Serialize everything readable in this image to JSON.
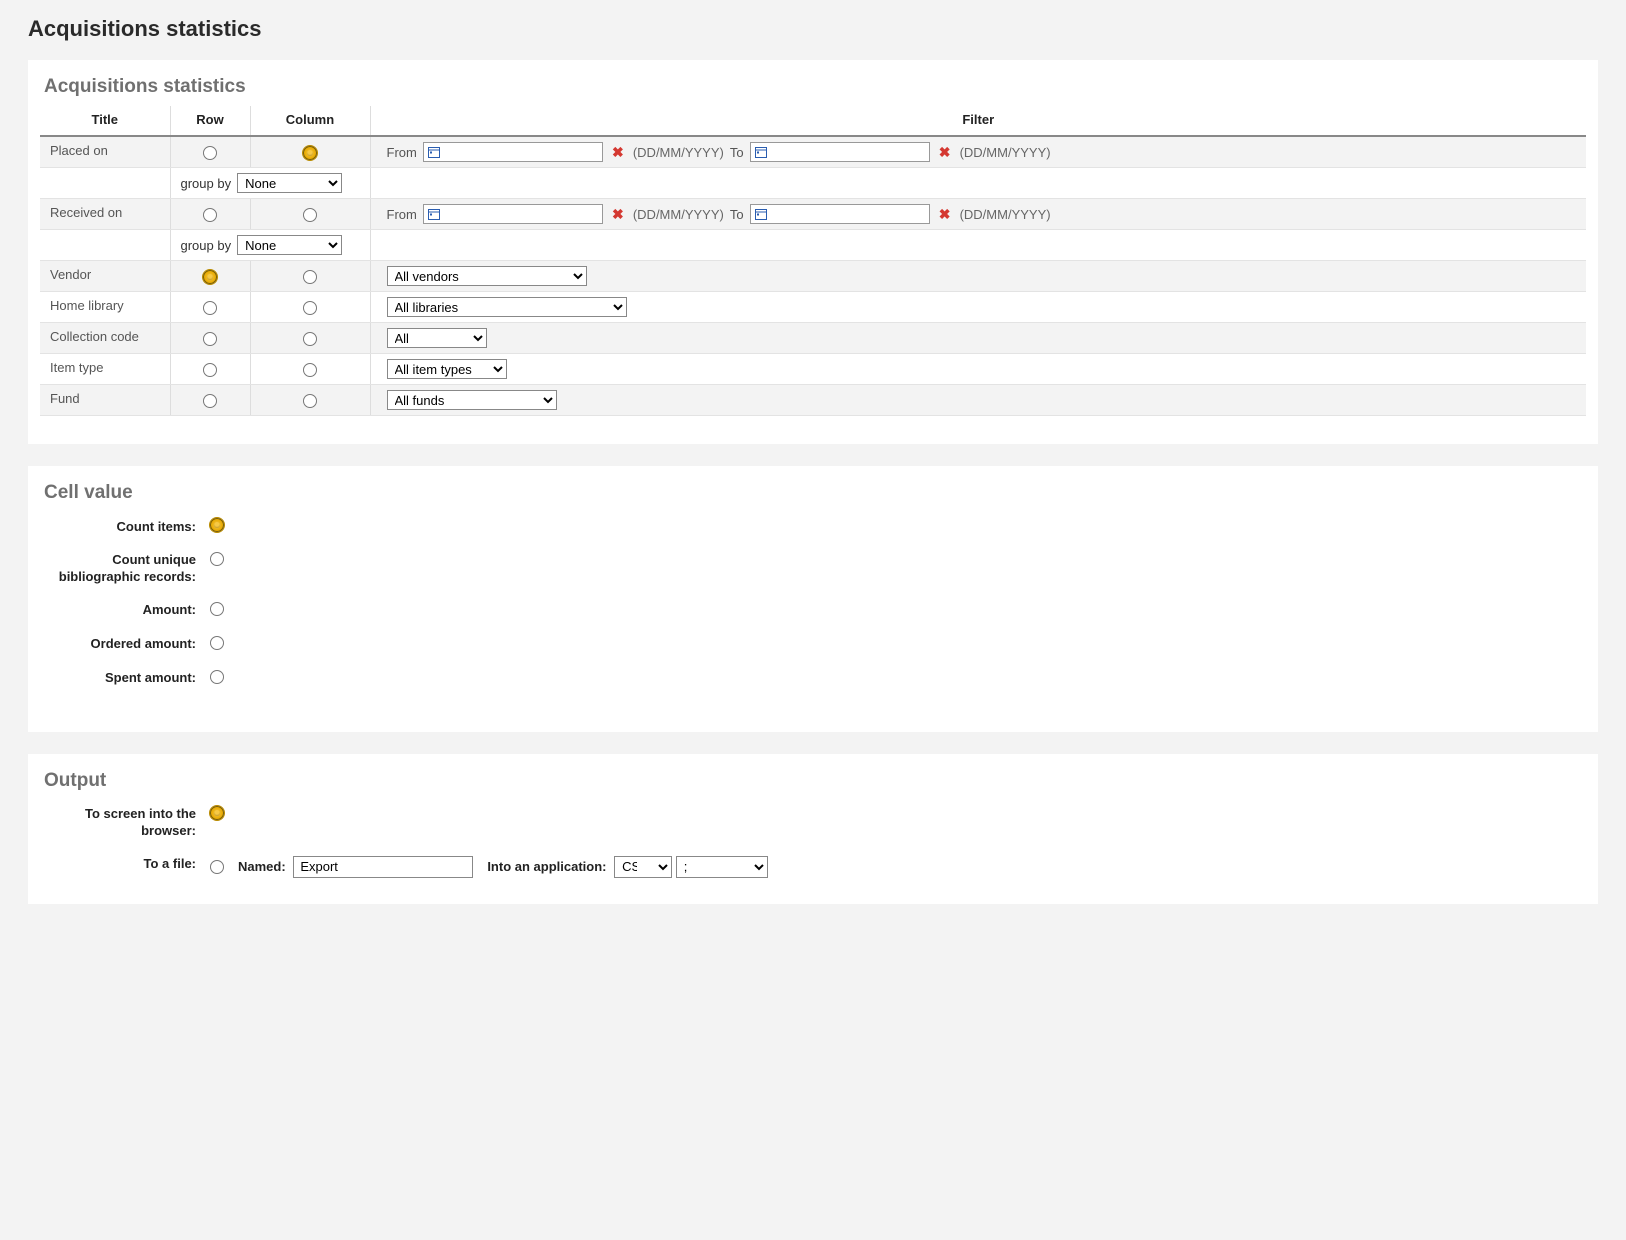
{
  "page": {
    "title": "Acquisitions statistics"
  },
  "section1": {
    "heading": "Acquisitions statistics",
    "headers": {
      "title": "Title",
      "row": "Row",
      "column": "Column",
      "filter": "Filter"
    },
    "rows": {
      "placed_on": "Placed on",
      "received_on": "Received on",
      "vendor": "Vendor",
      "home_library": "Home library",
      "collection_code": "Collection code",
      "item_type": "Item type",
      "fund": "Fund"
    },
    "group_by_label": "group by",
    "group_by_value": "None",
    "date_filter": {
      "from_label": "From",
      "to_label": "To",
      "hint": "(DD/MM/YYYY)"
    },
    "filters": {
      "vendor": "All vendors",
      "library": "All libraries",
      "collection": "All",
      "item_type": "All item types",
      "fund": "All funds"
    }
  },
  "section2": {
    "heading": "Cell value",
    "options": {
      "count_items": "Count items:",
      "count_unique": "Count unique bibliographic records:",
      "amount": "Amount:",
      "ordered_amount": "Ordered amount:",
      "spent_amount": "Spent amount:"
    }
  },
  "section3": {
    "heading": "Output",
    "to_screen_label": "To screen into the browser:",
    "to_file_label": "To a file:",
    "named_label": "Named:",
    "named_value": "Export",
    "into_app_label": "Into an application:",
    "format_value": "CSV",
    "delimiter_value": ";"
  }
}
